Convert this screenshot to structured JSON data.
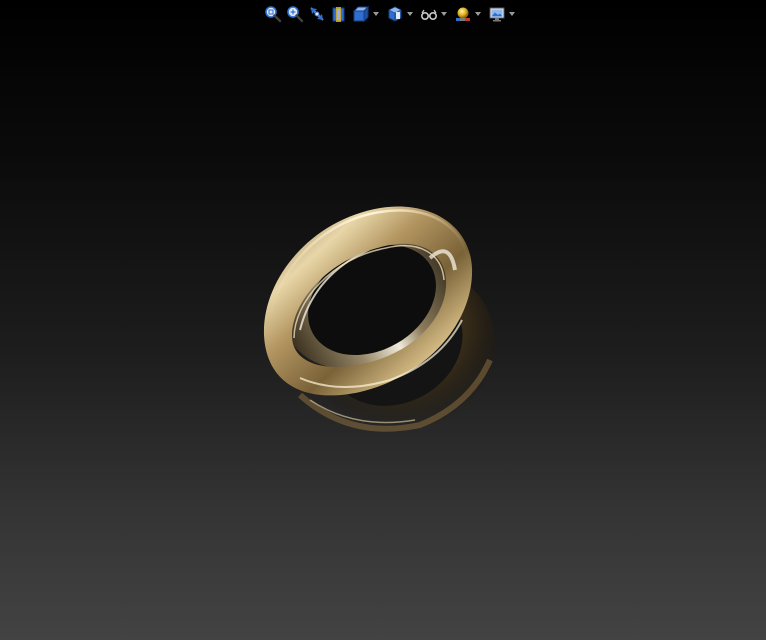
{
  "viewport": {
    "background_top": "#000000",
    "background_bottom": "#434343"
  },
  "toolbar": {
    "items": [
      {
        "icon": "zoom-to-fit-icon",
        "has_dropdown": false
      },
      {
        "icon": "zoom-to-area-icon",
        "has_dropdown": false
      },
      {
        "icon": "previous-view-icon",
        "has_dropdown": false
      },
      {
        "icon": "section-view-icon",
        "has_dropdown": false
      },
      {
        "icon": "view-orientation-icon",
        "has_dropdown": true
      },
      {
        "icon": "display-style-icon",
        "has_dropdown": true
      },
      {
        "icon": "hide-show-items-icon",
        "has_dropdown": true
      },
      {
        "icon": "edit-appearance-icon",
        "has_dropdown": true
      },
      {
        "icon": "apply-scene-icon",
        "has_dropdown": true
      }
    ],
    "icon_color": "#2f6fd0",
    "accent_color": "#e0b020"
  },
  "model": {
    "object": "ring",
    "material_color": "#b39661",
    "highlight_color": "#fff6dc",
    "shadow_color": "#3a2c16"
  }
}
